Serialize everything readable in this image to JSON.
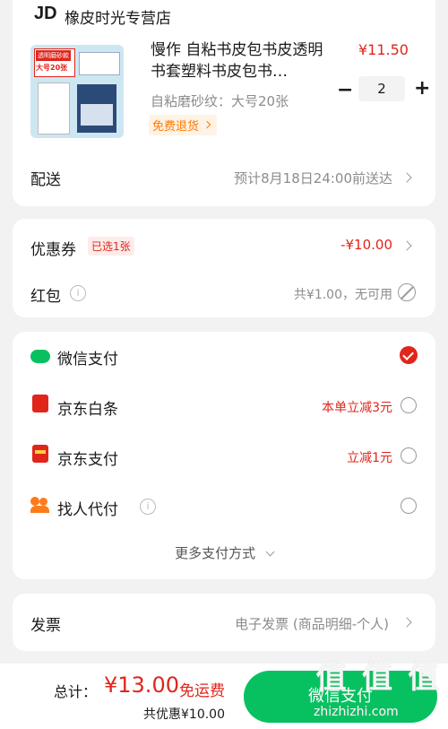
{
  "store": {
    "logo": "JD",
    "name": "橡皮时光专营店"
  },
  "product": {
    "thumb_badge": "透明磨砂款",
    "thumb_size": "大号20张",
    "title": "慢作 自粘书皮包书皮透明书套塑料书皮包书…",
    "price": "¥11.50",
    "variant": "自粘磨砂纹：大号20张",
    "return_tag": "免费退货",
    "qty_minus": "−",
    "quantity": "2",
    "qty_plus": "+"
  },
  "delivery": {
    "label": "配送",
    "value": "预计8月18日24:00前送达"
  },
  "coupon": {
    "label": "优惠券",
    "badge": "已选1张",
    "value": "-¥10.00"
  },
  "redpacket": {
    "label": "红包",
    "value": "共¥1.00，无可用"
  },
  "payment": {
    "methods": [
      {
        "label": "微信支付",
        "promo": "",
        "icon": "wechat-pay-icon",
        "selected": true
      },
      {
        "label": "京东白条",
        "promo": "本单立减3元",
        "icon": "jd-baitiao-icon",
        "selected": false
      },
      {
        "label": "京东支付",
        "promo": "立减1元",
        "icon": "jd-pay-icon",
        "selected": false
      },
      {
        "label": "找人代付",
        "promo": "",
        "icon": "friend-pay-icon",
        "selected": false
      }
    ],
    "more_label": "更多支付方式"
  },
  "invoice": {
    "label": "发票",
    "value": "电子发票 (商品明细-个人)"
  },
  "footer": {
    "total_label": "总计：",
    "total": "¥13.00",
    "free_shipping": "免运费",
    "discount": "共优惠¥10.00",
    "pay_button": "微信支付"
  },
  "watermark": {
    "mark": "值",
    "site": "zhizhizhi.com"
  },
  "colors": {
    "accent": "#e1251b",
    "pay_green": "#07c160",
    "background": "#f2f2f2"
  }
}
